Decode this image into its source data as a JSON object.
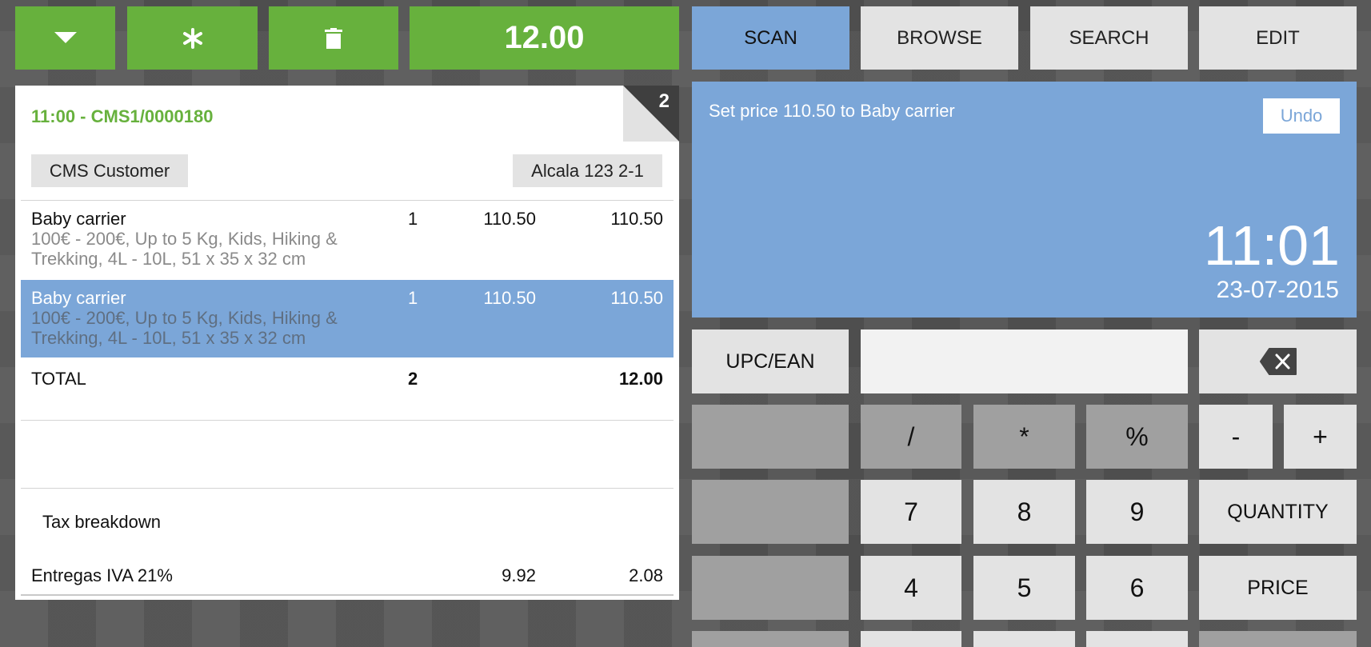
{
  "toolbar": {
    "menu_icon": "caret-down-icon",
    "favorites_icon": "asterisk-icon",
    "delete_icon": "trash-icon",
    "total": "12.00"
  },
  "modes": {
    "items": [
      "SCAN",
      "BROWSE",
      "SEARCH",
      "EDIT"
    ],
    "active": "SCAN"
  },
  "receipt": {
    "corner_number": "2",
    "id": "11:00 - CMS1/0000180",
    "customer": "CMS Customer",
    "address": "Alcala 123 2-1",
    "lines": [
      {
        "name": "Baby carrier",
        "desc": "100€ - 200€, Up to 5 Kg, Kids, Hiking & Trekking, 4L - 10L, 51 x 35 x 32 cm",
        "qty": "1",
        "price": "110.50",
        "amount": "110.50",
        "selected": false
      },
      {
        "name": "Baby carrier",
        "desc": "100€ - 200€, Up to 5 Kg, Kids, Hiking & Trekking, 4L - 10L, 51 x 35 x 32 cm",
        "qty": "1",
        "price": "110.50",
        "amount": "110.50",
        "selected": true
      }
    ],
    "total_label": "TOTAL",
    "total_qty": "2",
    "total_amount": "12.00",
    "tax_heading": "Tax breakdown",
    "tax": {
      "label": "Entregas IVA 21%",
      "base": "9.92",
      "amount": "2.08"
    }
  },
  "info": {
    "message": "Set price 110.50 to Baby carrier",
    "undo_label": "Undo",
    "time": "11:01",
    "date": "23-07-2015"
  },
  "keypad": {
    "upc_label": "UPC/EAN",
    "input_value": "",
    "backspace_icon": "backspace-icon",
    "slash": "/",
    "asterisk": "*",
    "percent": "%",
    "minus": "-",
    "plus": "+",
    "seven": "7",
    "eight": "8",
    "nine": "9",
    "quantity_label": "QUANTITY",
    "four": "4",
    "five": "5",
    "six": "6",
    "price_label": "PRICE"
  },
  "colors": {
    "green": "#67b13d",
    "blue": "#7ba6d8",
    "light_key": "#e3e3e3",
    "dark_key": "#a0a0a0"
  }
}
